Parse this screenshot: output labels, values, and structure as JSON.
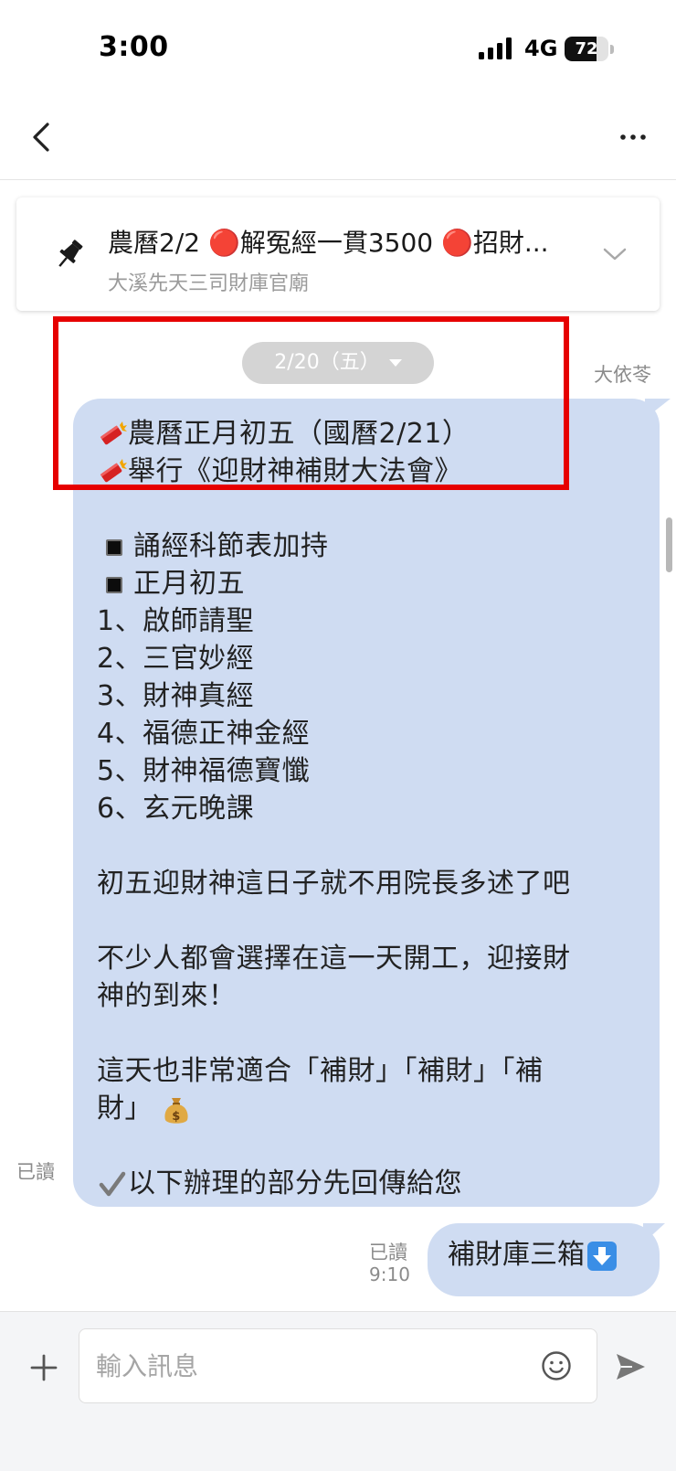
{
  "status_bar": {
    "time": "3:00",
    "network": "4G",
    "battery": "72",
    "battery_level": 0.72
  },
  "pinned": {
    "title": "農曆2/2 🔴解冤經一貫3500 🔴招財...",
    "subtitle": "大溪先天三司財庫官廟"
  },
  "date_separator": "2/20（五）",
  "incoming_message": {
    "sender": "大依苓",
    "lines": [
      "農曆正月初五（國曆2/21）",
      "舉行《迎財神補財大法會》",
      "",
      "誦經科節表加持",
      "正月初五",
      "1、啟師請聖",
      "2、三官妙經",
      "3、財神真經",
      "4、福德正神金經",
      "5、財神福德寶懺",
      "6、玄元晚課",
      "",
      "初五迎財神這日子就不用院長多述了吧",
      "",
      "不少人都會選擇在這一天開工，迎接財",
      "神的到來！",
      "",
      "這天也非常適合「補財」「補財」「補",
      "財」",
      "",
      "以下辦理的部分先回傳給您"
    ],
    "read_status": "已讀"
  },
  "outgoing_message": {
    "text": "補財庫三箱",
    "read_status": "已讀",
    "time": "9:10"
  },
  "input": {
    "placeholder": "輸入訊息"
  },
  "colors": {
    "bubble": "#cfdcf2",
    "highlight": "#e60000",
    "date_pill": "#d4d4d4"
  }
}
